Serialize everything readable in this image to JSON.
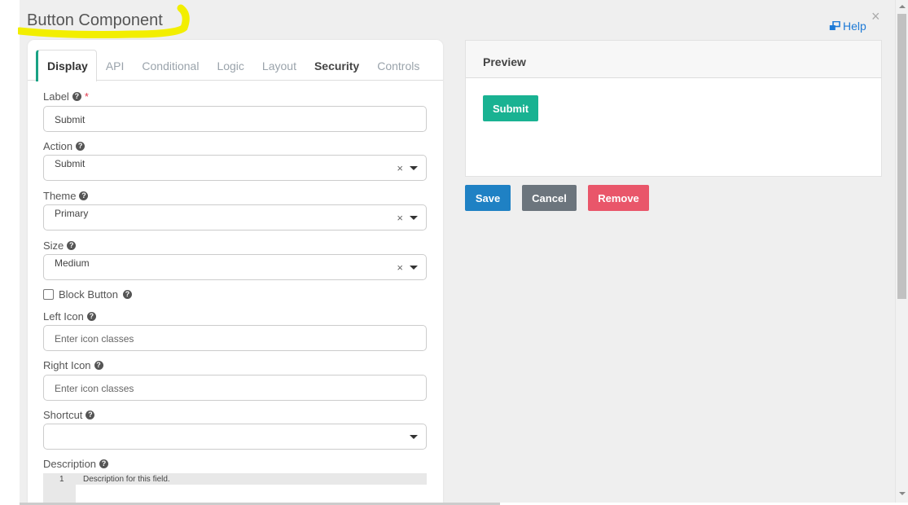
{
  "dialog": {
    "title": "Button Component",
    "help_label": "Help",
    "close_glyph": "×"
  },
  "tabs": [
    {
      "label": "Display",
      "active": true
    },
    {
      "label": "API"
    },
    {
      "label": "Conditional"
    },
    {
      "label": "Logic"
    },
    {
      "label": "Layout"
    },
    {
      "label": "Security"
    },
    {
      "label": "Controls"
    }
  ],
  "form": {
    "label_field": {
      "label": "Label",
      "required_mark": "*",
      "value": "Submit"
    },
    "action_field": {
      "label": "Action",
      "value": "Submit"
    },
    "theme_field": {
      "label": "Theme",
      "value": "Primary"
    },
    "size_field": {
      "label": "Size",
      "value": "Medium"
    },
    "block_button": {
      "label": "Block Button",
      "checked": false
    },
    "left_icon": {
      "label": "Left Icon",
      "placeholder": "Enter icon classes"
    },
    "right_icon": {
      "label": "Right Icon",
      "placeholder": "Enter icon classes"
    },
    "shortcut": {
      "label": "Shortcut",
      "value": ""
    },
    "description": {
      "label": "Description",
      "line_number": "1",
      "line_text": "Description for this field."
    },
    "clear_glyph": "×",
    "help_glyph": "?"
  },
  "preview": {
    "header": "Preview",
    "submit_label": "Submit"
  },
  "actions": {
    "save_label": "Save",
    "cancel_label": "Cancel",
    "remove_label": "Remove"
  },
  "colors": {
    "accent_green": "#19b292",
    "save_blue": "#1f81c4",
    "cancel_gray": "#6c757d",
    "remove_red": "#e9566a",
    "help_blue": "#1e7ad6",
    "highlight_yellow": "#f2ee00"
  },
  "icons": {
    "help_link_icon": "external-window-icon",
    "question_icon": "question-circle-icon"
  }
}
